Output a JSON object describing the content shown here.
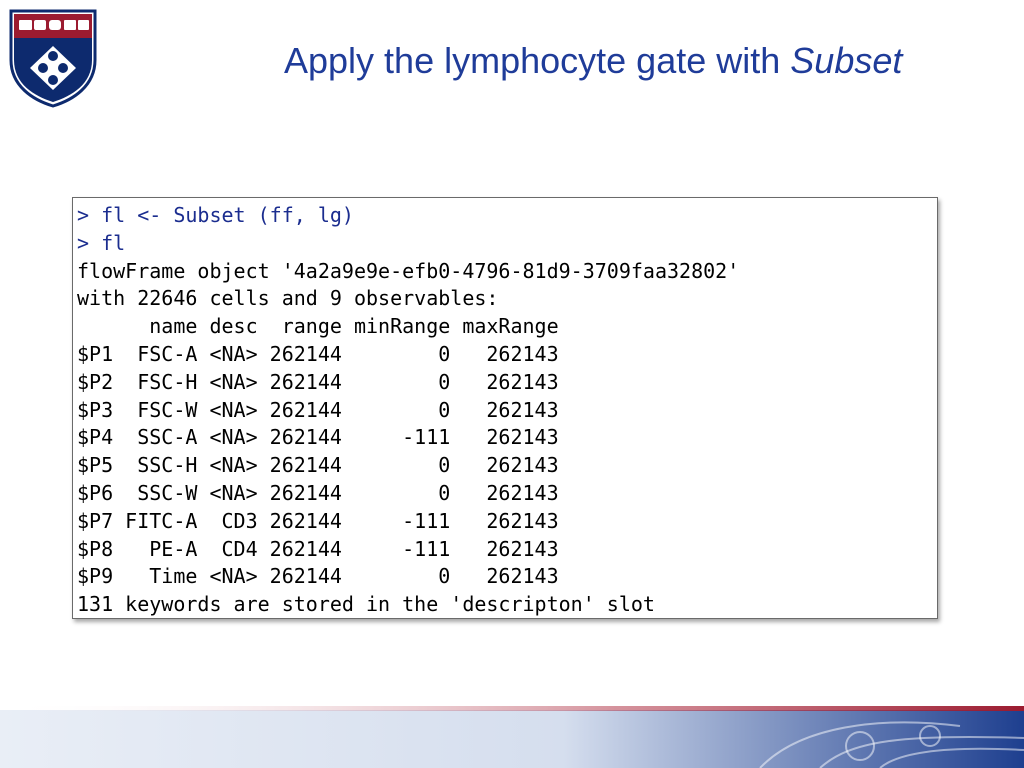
{
  "slide": {
    "title_main": "Apply the lymphocyte gate with ",
    "title_emph": "Subset"
  },
  "console": {
    "commands": [
      "> fl <- Subset (ff, lg)",
      "> fl"
    ],
    "output": [
      "flowFrame object '4a2a9e9e-efb0-4796-81d9-3709faa32802'",
      "with 22646 cells and 9 observables:",
      "      name desc  range minRange maxRange",
      "$P1  FSC-A <NA> 262144        0   262143",
      "$P2  FSC-H <NA> 262144        0   262143",
      "$P3  FSC-W <NA> 262144        0   262143",
      "$P4  SSC-A <NA> 262144     -111   262143",
      "$P5  SSC-H <NA> 262144        0   262143",
      "$P6  SSC-W <NA> 262144        0   262143",
      "$P7 FITC-A  CD3 262144     -111   262143",
      "$P8   PE-A  CD4 262144     -111   262143",
      "$P9   Time <NA> 262144        0   262143",
      "131 keywords are stored in the 'descripton' slot"
    ]
  },
  "colors": {
    "title": "#1f3c99",
    "command": "#1b2d8f",
    "shield_red": "#9b1b30",
    "shield_blue": "#0d2a6e"
  },
  "icons": {
    "logo": "university-shield-icon"
  }
}
